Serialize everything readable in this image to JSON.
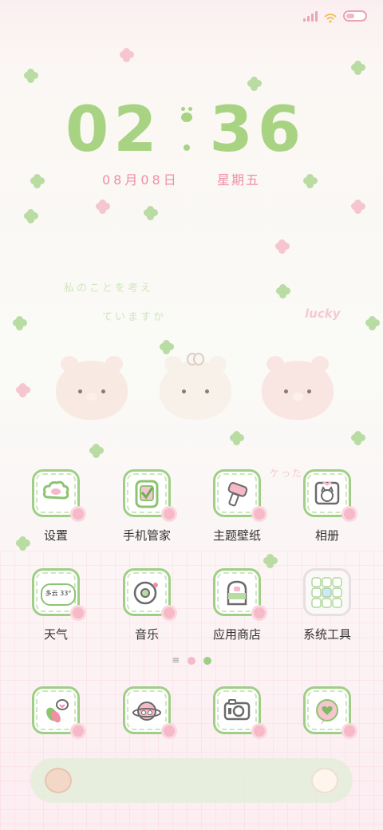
{
  "status_bar": {
    "signal_bars": 4,
    "wifi": "wifi-icon",
    "battery_icon": "battery-icon"
  },
  "clock": {
    "hour": "02",
    "minute": "36"
  },
  "date": {
    "date_text": "08月08日",
    "weekday_text": "星期五"
  },
  "wallpaper_text": {
    "line1": "私のことを考え",
    "line2": "ていますか",
    "lucky": "lucky",
    "line3": "ケった ・ ・"
  },
  "apps_row1": [
    {
      "label": "设置",
      "icon": "settings-cloud-icon"
    },
    {
      "label": "手机管家",
      "icon": "phone-manager-check-icon"
    },
    {
      "label": "主题壁纸",
      "icon": "theme-brush-icon"
    },
    {
      "label": "相册",
      "icon": "album-cat-frame-icon"
    }
  ],
  "apps_row2": [
    {
      "label": "天气",
      "icon": "weather-cloud-icon",
      "badge": "多云 33°"
    },
    {
      "label": "音乐",
      "icon": "music-record-icon"
    },
    {
      "label": "应用商店",
      "icon": "app-store-bag-icon"
    },
    {
      "label": "系统工具",
      "icon": "system-tools-folder-icon"
    }
  ],
  "dock_apps": [
    {
      "icon": "phone-beans-icon"
    },
    {
      "icon": "browser-planet-icon"
    },
    {
      "icon": "camera-icon"
    },
    {
      "icon": "message-heart-icon"
    }
  ],
  "pager": {
    "symbol": "≡"
  },
  "colors": {
    "accent_green": "#a8d383",
    "accent_pink": "#f08fa6",
    "tile_border": "#9fcf86"
  }
}
